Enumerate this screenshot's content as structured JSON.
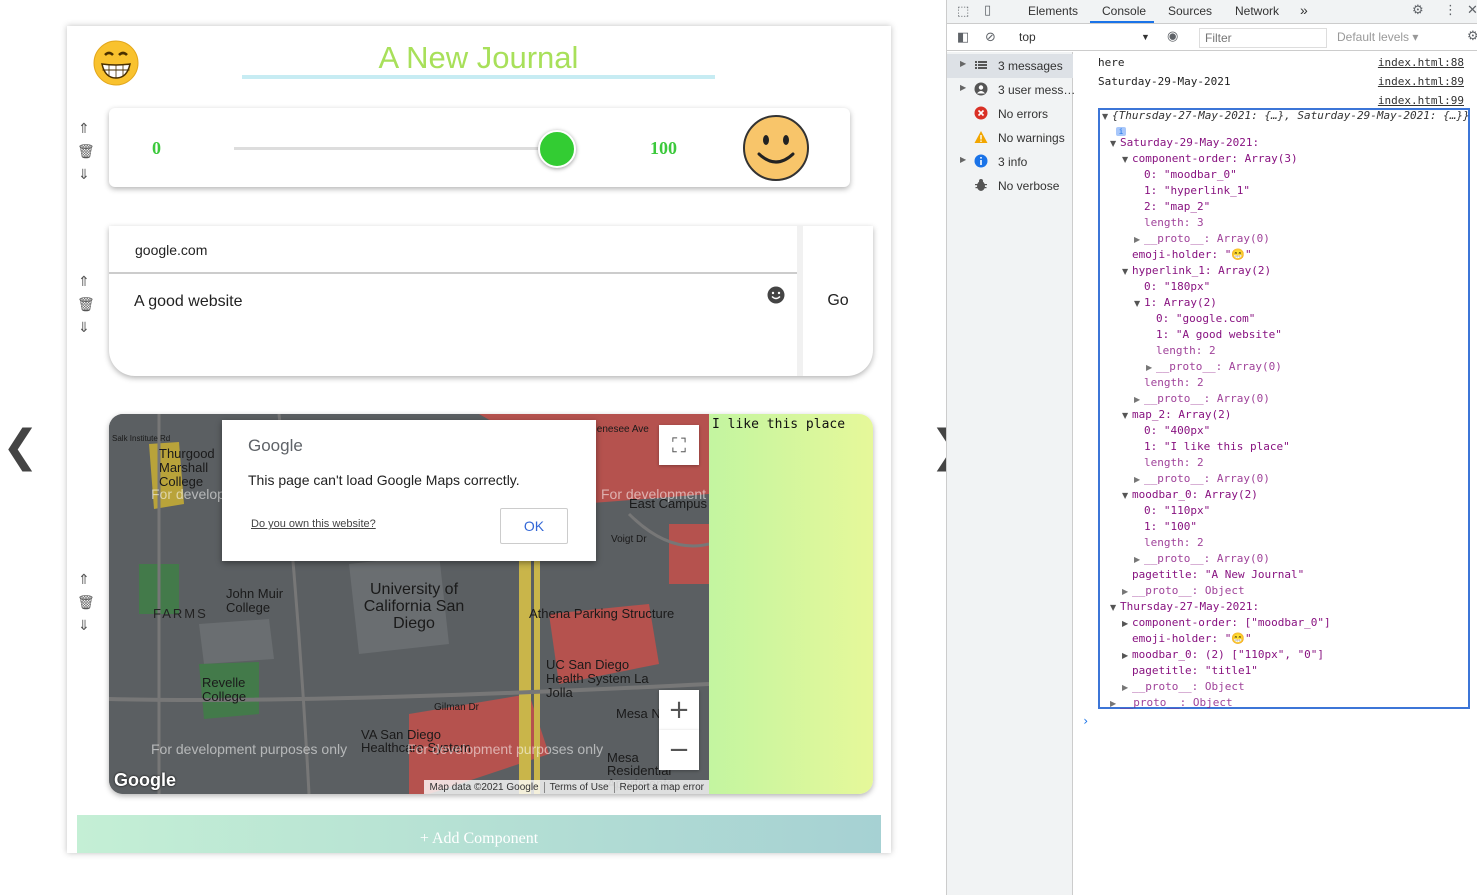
{
  "app": {
    "page_title": "A New Journal",
    "nav": {
      "prev": "❮",
      "next": "❯"
    },
    "side_controls": {
      "up": "⇑",
      "delete": "🗑",
      "down": "⇓"
    },
    "moodbar": {
      "min_label": "0",
      "max_label": "100",
      "value": 100
    },
    "hyperlink": {
      "url": "google.com",
      "description": "A good website",
      "go_label": "Go"
    },
    "map": {
      "note_text": "I like this place",
      "dialog": {
        "logo": "Google",
        "message": "This page can't load Google Maps correctly.",
        "link": "Do you own this website?",
        "ok_label": "OK"
      },
      "dev_notice": "For development purposes only",
      "labels": {
        "thurgood": "Thurgood Marshall College",
        "salk": "Salk Institute Rd",
        "farms": "FARMS",
        "muir": "John Muir College",
        "ucsd": "University of California San Diego",
        "athena": "Athena Parking Structure",
        "east_campus": "East Campus",
        "ucsd_health": "UC San Diego Health System La Jolla",
        "revelle": "Revelle College",
        "va": "VA San Diego Healthcare System",
        "mesa_nueva": "Mesa Nueva",
        "mesa_res": "Mesa Residential Apartments",
        "gilman": "Gilman Dr",
        "voigt": "Voigt Dr",
        "genesee": "Genesee Ave",
        "google_logo": "Google"
      },
      "zoom_in": "+",
      "zoom_out": "−",
      "footer": [
        "Map data ©2021 Google",
        "Terms of Use",
        "Report a map error"
      ]
    },
    "add_component": "+ Add Component"
  },
  "devtools": {
    "tabs": [
      "Elements",
      "Console",
      "Sources",
      "Network"
    ],
    "more_tabs": "»",
    "context": "top",
    "filter_placeholder": "Filter",
    "levels": "Default levels ▾",
    "sidebar": [
      {
        "label": "3 messages",
        "icon": "list-icon",
        "expandable": true
      },
      {
        "label": "3 user mess…",
        "icon": "user-icon",
        "expandable": true
      },
      {
        "label": "No errors",
        "icon": "error-icon",
        "expandable": false
      },
      {
        "label": "No warnings",
        "icon": "warning-icon",
        "expandable": false
      },
      {
        "label": "3 info",
        "icon": "info-icon",
        "expandable": true
      },
      {
        "label": "No verbose",
        "icon": "bug-icon",
        "expandable": false
      }
    ],
    "logs": [
      {
        "text": "here",
        "source": "index.html:88"
      },
      {
        "text": "Saturday-29-May-2021",
        "source": "index.html:89"
      },
      {
        "text": "",
        "source": "index.html:99"
      }
    ],
    "object_tree": [
      "{Thursday-27-May-2021: {…}, Saturday-29-May-2021: {…}}",
      "Saturday-29-May-2021:",
      "component-order: Array(3)",
      "0: \"moodbar_0\"",
      "1: \"hyperlink_1\"",
      "2: \"map_2\"",
      "length: 3",
      "__proto__: Array(0)",
      "emoji-holder: \"😁\"",
      "hyperlink_1: Array(2)",
      "0: \"180px\"",
      "1: Array(2)",
      "0: \"google.com\"",
      "1: \"A good website\"",
      "length: 2",
      "__proto__: Array(0)",
      "length: 2",
      "__proto__: Array(0)",
      "map_2: Array(2)",
      "0: \"400px\"",
      "1: \"I like this place\"",
      "length: 2",
      "__proto__: Array(0)",
      "moodbar_0: Array(2)",
      "0: \"110px\"",
      "1: \"100\"",
      "length: 2",
      "__proto__: Array(0)",
      "pagetitle: \"A New Journal\"",
      "__proto__: Object",
      "Thursday-27-May-2021:",
      "component-order: [\"moodbar_0\"]",
      "emoji-holder: \"😁\"",
      "moodbar_0: (2) [\"110px\", \"0\"]",
      "pagetitle: \"title1\"",
      "__proto__: Object",
      "__proto__: Object"
    ],
    "prompt": "›",
    "colors": {
      "accent": "#1a73e8",
      "key": "#881280",
      "string": "#c41a16"
    }
  }
}
